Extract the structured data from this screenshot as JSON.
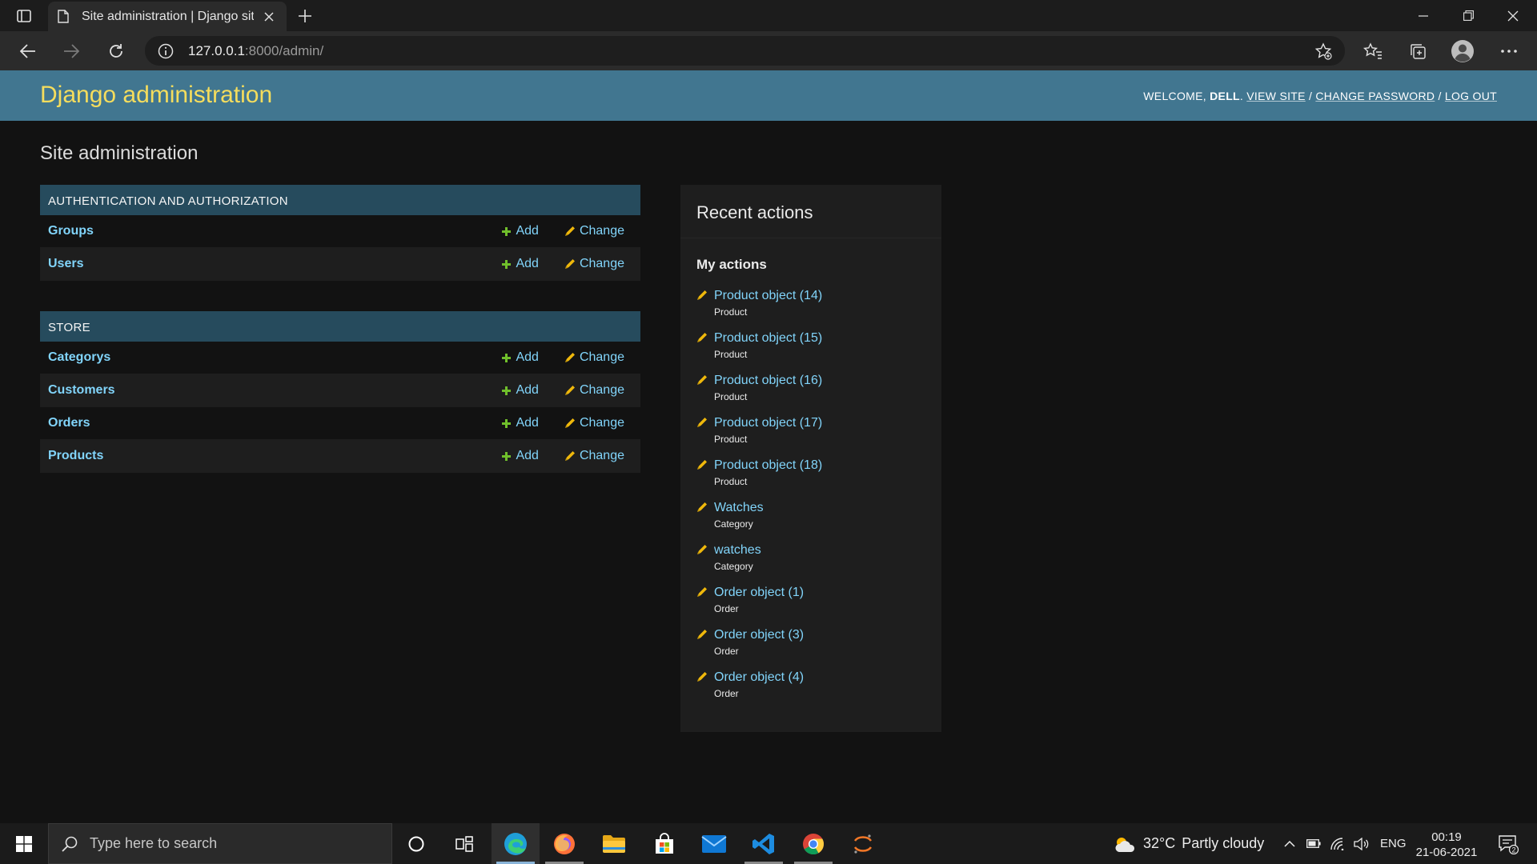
{
  "browser": {
    "tab_title": "Site administration | Django site admin",
    "url_host": "127.0.0.1",
    "url_rest": ":8000/admin/"
  },
  "header": {
    "brand": "Django administration",
    "welcome": "WELCOME,",
    "username": "DELL",
    "view_site": "VIEW SITE",
    "change_password": "CHANGE PASSWORD",
    "log_out": "LOG OUT",
    "sep": " / "
  },
  "content": {
    "title": "Site administration",
    "add_label": "Add",
    "change_label": "Change",
    "modules": [
      {
        "caption": "AUTHENTICATION AND AUTHORIZATION",
        "models": [
          "Groups",
          "Users"
        ]
      },
      {
        "caption": "STORE",
        "models": [
          "Categorys",
          "Customers",
          "Orders",
          "Products"
        ]
      }
    ]
  },
  "recent": {
    "title": "Recent actions",
    "subtitle": "My actions",
    "actions": [
      {
        "name": "Product object (14)",
        "type": "Product"
      },
      {
        "name": "Product object (15)",
        "type": "Product"
      },
      {
        "name": "Product object (16)",
        "type": "Product"
      },
      {
        "name": "Product object (17)",
        "type": "Product"
      },
      {
        "name": "Product object (18)",
        "type": "Product"
      },
      {
        "name": "Watches",
        "type": "Category"
      },
      {
        "name": "watches",
        "type": "Category"
      },
      {
        "name": "Order object (1)",
        "type": "Order"
      },
      {
        "name": "Order object (3)",
        "type": "Order"
      },
      {
        "name": "Order object (4)",
        "type": "Order"
      }
    ]
  },
  "taskbar": {
    "search_placeholder": "Type here to search",
    "weather_temp": "32°C",
    "weather_desc": "Partly cloudy",
    "language": "ENG",
    "time": "00:19",
    "date": "21-06-2021",
    "notification_count": "2"
  },
  "colors": {
    "header_bg": "#417690",
    "brand": "#f5dd5d",
    "module_caption_bg": "#264b5d",
    "link": "#81d4fa",
    "add_icon": "#70bf2b",
    "change_icon": "#efb80b"
  }
}
